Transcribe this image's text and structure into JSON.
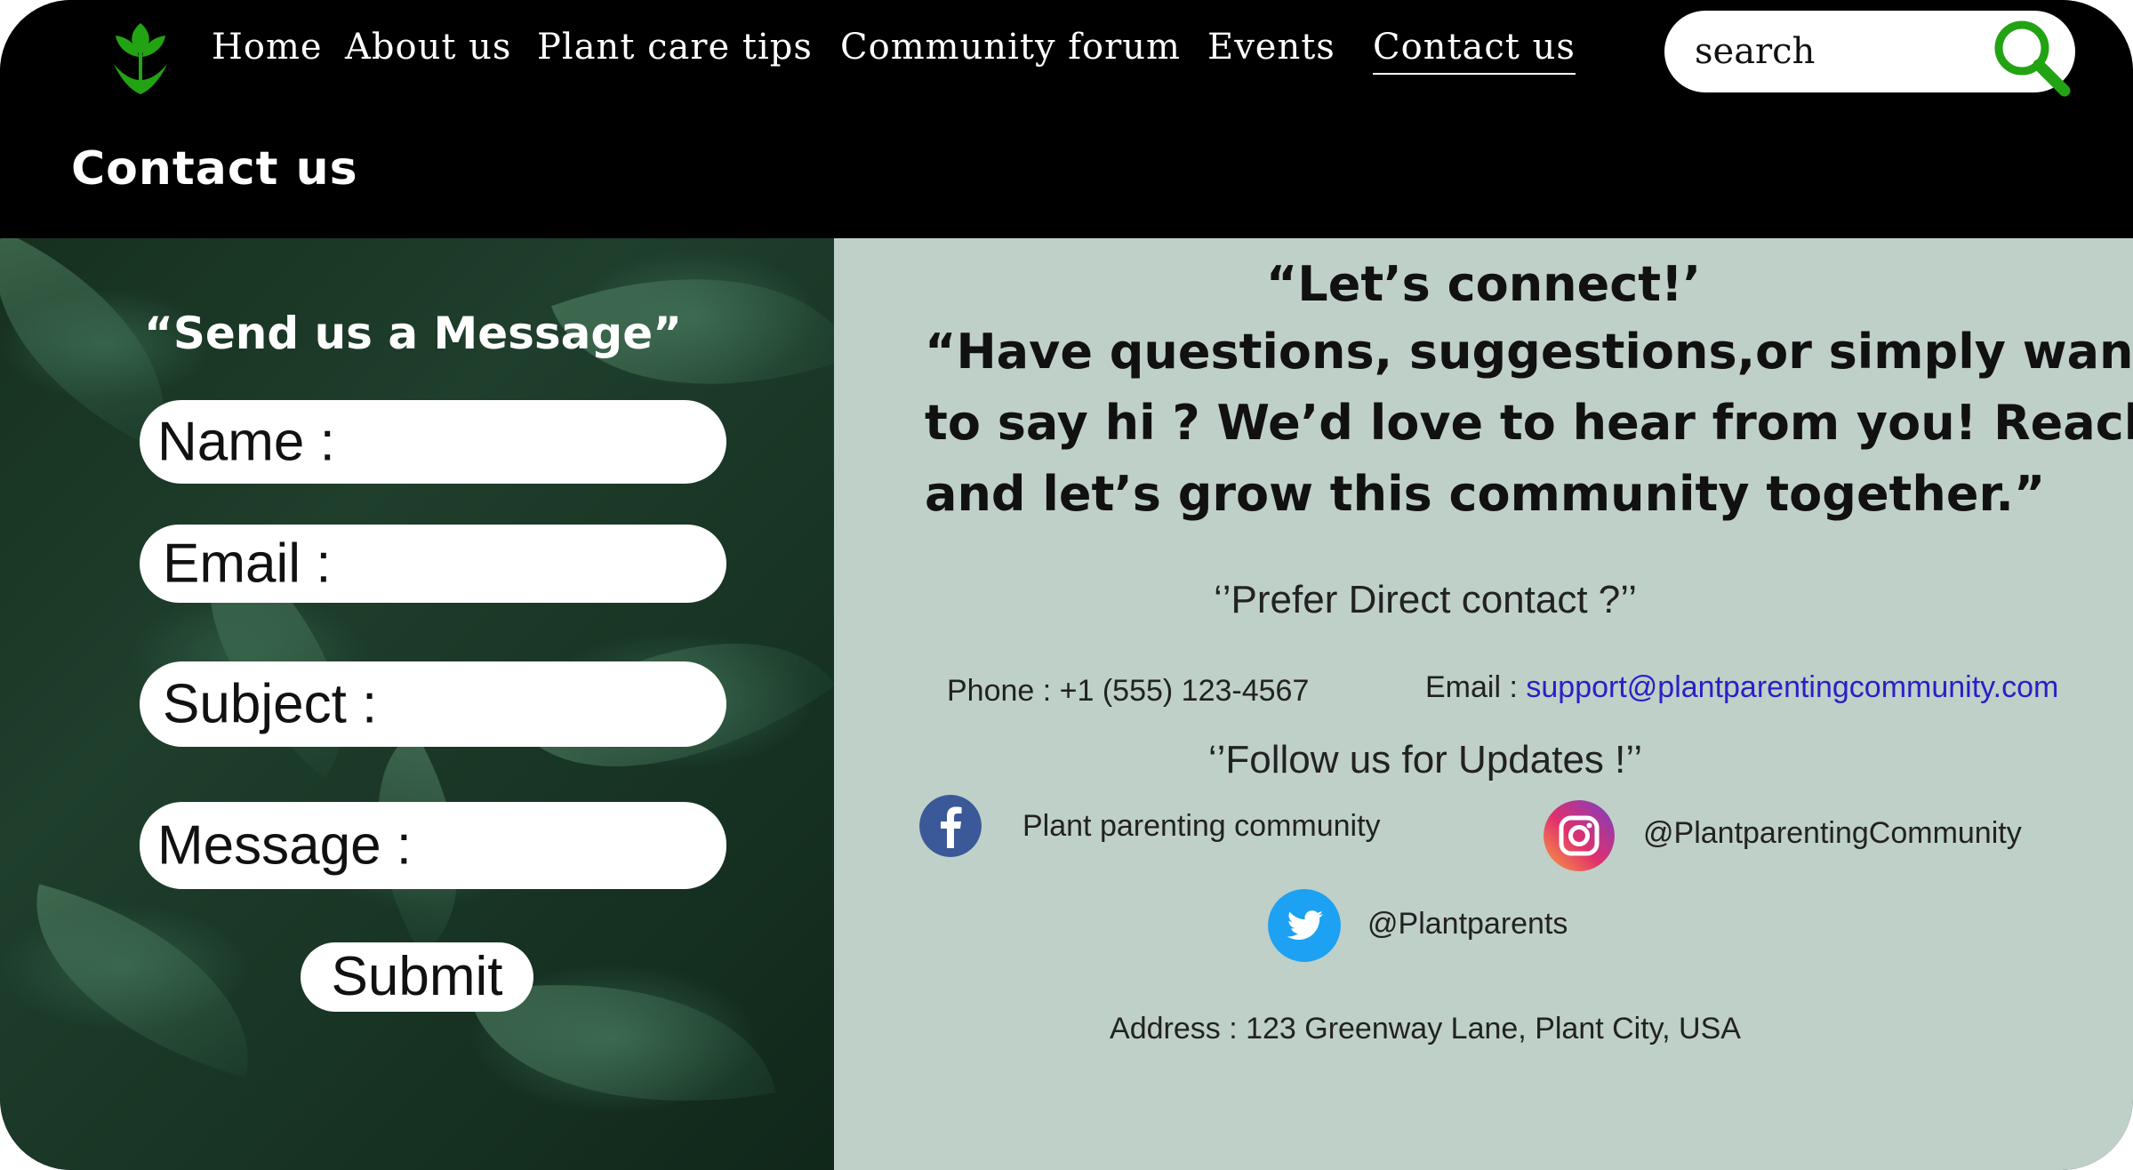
{
  "nav": {
    "items": [
      {
        "label": "Home"
      },
      {
        "label": "About us"
      },
      {
        "label": "Plant care tips"
      },
      {
        "label": "Community forum"
      },
      {
        "label": "Events"
      },
      {
        "label": "Contact us",
        "active": true
      }
    ]
  },
  "search": {
    "placeholder": "search",
    "icon": "magnifier-icon"
  },
  "page": {
    "title": "Contact us"
  },
  "form": {
    "title": "“Send us a Message”",
    "fields": {
      "name": "Name :",
      "email": "Email :",
      "subject": "Subject :",
      "message": "Message :"
    },
    "submit_label": "Submit"
  },
  "contact": {
    "heading": "“Let’s connect!’",
    "intro_lines": [
      "“Have questions, suggestions,or simply want",
      "to say hi ? We’d love to hear from you! Reach to us,",
      "and let’s grow this community together.”"
    ],
    "prefer_title": "‘’Prefer Direct contact ?’’",
    "phone": "Phone : +1  (555) 123-4567",
    "email_label": "Email :",
    "email_value": "support@plantparentingcommunity.com",
    "follow_title": "‘’Follow us for Updates !’’",
    "social": {
      "facebook": "Plant parenting community",
      "instagram": "@PlantparentingCommunity",
      "twitter": "@Plantparents"
    },
    "address": "Address :  123  Greenway Lane,  Plant City, USA"
  },
  "colors": {
    "header_bg": "#000000",
    "right_panel_bg": "#bfd0c8",
    "accent_green": "#22a313",
    "link_blue": "#2a1fc7",
    "facebook_blue": "#3b5998",
    "twitter_blue": "#1da1f2"
  }
}
